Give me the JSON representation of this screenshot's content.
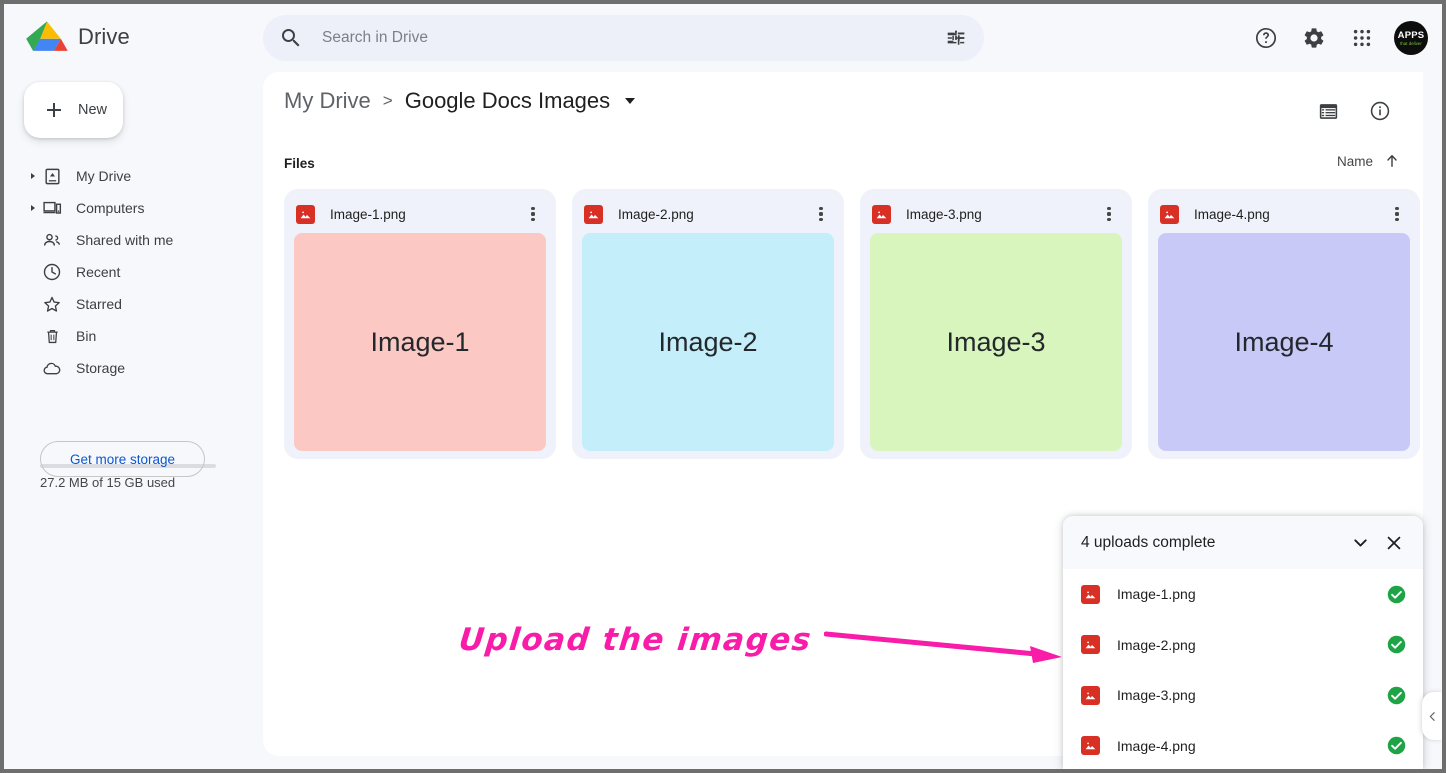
{
  "app": {
    "brand_title": "Drive",
    "logo_icon": "drive-logo"
  },
  "search": {
    "placeholder": "Search in Drive",
    "value": "",
    "search_icon": "search-icon",
    "tune_icon": "tune-icon"
  },
  "topright": {
    "help_icon": "help-circle-icon",
    "settings_icon": "gear-icon",
    "apps_icon": "apps-grid-icon",
    "avatar_main": "APPS",
    "avatar_sub": "that deliver"
  },
  "sidebar": {
    "new_label": "New",
    "new_icon": "plus-icon",
    "items": [
      {
        "label": "My Drive",
        "icon": "my-drive-icon",
        "expandable": true
      },
      {
        "label": "Computers",
        "icon": "computers-icon",
        "expandable": true
      },
      {
        "label": "Shared with me",
        "icon": "shared-with-me-icon",
        "expandable": false
      },
      {
        "label": "Recent",
        "icon": "clock-icon",
        "expandable": false
      },
      {
        "label": "Starred",
        "icon": "star-icon",
        "expandable": false
      },
      {
        "label": "Bin",
        "icon": "trash-icon",
        "expandable": false
      },
      {
        "label": "Storage",
        "icon": "cloud-icon",
        "expandable": false
      }
    ],
    "storage_text": "27.2 MB of 15 GB used",
    "storage_button": "Get more storage"
  },
  "breadcrumb": {
    "root": "My Drive",
    "separator": ">",
    "current": "Google Docs Images"
  },
  "content_tools": {
    "list_view_icon": "list-view-icon",
    "info_icon": "info-circle-icon"
  },
  "files_section": {
    "heading": "Files",
    "sort_label": "Name",
    "sort_icon": "arrow-up-icon"
  },
  "files": [
    {
      "name": "Image-1.png",
      "thumb_label": "Image-1",
      "thumb_color": "#fbc8c4",
      "icon": "image-file-icon"
    },
    {
      "name": "Image-2.png",
      "thumb_label": "Image-2",
      "thumb_color": "#c5eefb",
      "icon": "image-file-icon"
    },
    {
      "name": "Image-3.png",
      "thumb_label": "Image-3",
      "thumb_color": "#d8f5be",
      "icon": "image-file-icon"
    },
    {
      "name": "Image-4.png",
      "thumb_label": "Image-4",
      "thumb_color": "#c8c9f7",
      "icon": "image-file-icon"
    }
  ],
  "annotation": {
    "text": "Upload the images",
    "color": "#f81ca8",
    "arrow_icon": "arrow-right-annotation"
  },
  "upload_toast": {
    "title": "4 uploads complete",
    "collapse_icon": "chevron-down-icon",
    "close_icon": "close-icon",
    "rows": [
      {
        "name": "Image-1.png",
        "icon": "image-file-icon",
        "status_icon": "check-circle-icon"
      },
      {
        "name": "Image-2.png",
        "icon": "image-file-icon",
        "status_icon": "check-circle-icon"
      },
      {
        "name": "Image-3.png",
        "icon": "image-file-icon",
        "status_icon": "check-circle-icon"
      },
      {
        "name": "Image-4.png",
        "icon": "image-file-icon",
        "status_icon": "check-circle-icon"
      }
    ],
    "status_color": "#1ea446"
  },
  "collapse_tab": {
    "icon": "chevron-left-icon"
  }
}
